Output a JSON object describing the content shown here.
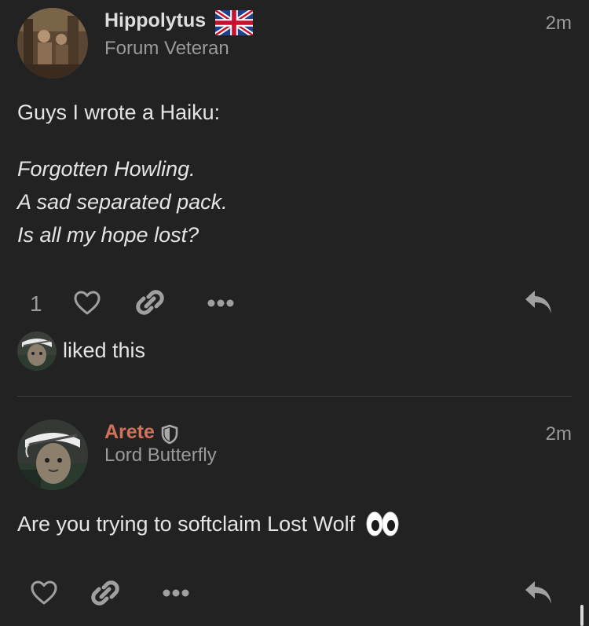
{
  "posts": [
    {
      "username": "Hippolytus",
      "user_title": "Forum Veteran",
      "time": "2m",
      "intro": "Guys I wrote a Haiku:",
      "haiku": [
        "Forgotten Howling.",
        "A sad separated pack.",
        "Is all my hope lost?"
      ],
      "like_count": "1",
      "liked_text": "liked this",
      "flag_icon": "uk-flag-icon",
      "name_color": "#dddddd"
    },
    {
      "username": "Arete",
      "user_title": "Lord Butterfly",
      "time": "2m",
      "text": "Are you trying to softclaim Lost Wolf",
      "badge_icon": "shield-icon",
      "emoji_icon": "eyes-emoji-icon",
      "name_color": "#d3725a"
    }
  ],
  "icons": {
    "like": "heart-icon",
    "share": "link-icon",
    "more": "ellipsis-icon",
    "reply": "reply-icon"
  },
  "colors": {
    "background": "#222222",
    "text": "#e4e4e4",
    "muted": "#9a9a9a",
    "accent": "#d3725a"
  }
}
